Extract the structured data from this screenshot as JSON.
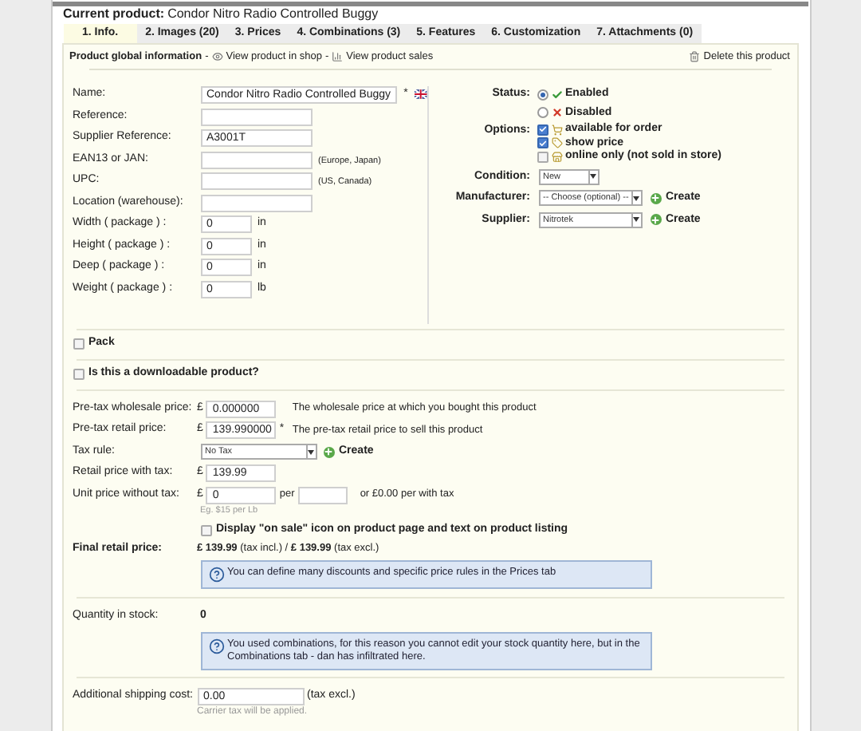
{
  "current_product": {
    "label": "Current product:",
    "name": "Condor Nitro Radio Controlled Buggy"
  },
  "tabs": [
    {
      "label": "1. Info.",
      "selected": true
    },
    {
      "label": "2. Images (20)",
      "selected": false
    },
    {
      "label": "3. Prices",
      "selected": false
    },
    {
      "label": "4. Combinations (3)",
      "selected": false
    },
    {
      "label": "5. Features",
      "selected": false
    },
    {
      "label": "6. Customization",
      "selected": false
    },
    {
      "label": "7. Attachments (0)",
      "selected": false
    }
  ],
  "toolbar": {
    "title": "Product global information",
    "separator_1": "-",
    "view_shop": "View product in shop",
    "separator_2": "-",
    "view_sales": "View product sales",
    "delete": "Delete this product"
  },
  "fields": [
    {
      "label": "Name:",
      "value": "Condor Nitro Radio Controlled Buggy",
      "kind": "long",
      "required": "*",
      "flag": true
    },
    {
      "label": "Reference:",
      "kind": "medium"
    },
    {
      "label": "Supplier Reference:",
      "value": "A3001T",
      "kind": "medium"
    },
    {
      "label": "EAN13 or JAN:",
      "kind": "medium",
      "note": "(Europe, Japan)"
    },
    {
      "label": "UPC:",
      "kind": "medium",
      "note": "(US, Canada)"
    },
    {
      "label": "Location (warehouse):",
      "kind": "medium"
    },
    {
      "label": "Width ( package ) :",
      "value": "0",
      "kind": "short",
      "unit": "in"
    },
    {
      "label": "Height ( package ) :",
      "value": "0",
      "kind": "short",
      "unit": "in"
    },
    {
      "label": "Deep ( package ) :",
      "value": "0",
      "kind": "short",
      "unit": "in"
    },
    {
      "label": "Weight ( package ) :",
      "value": "0",
      "kind": "short",
      "unit": "lb"
    }
  ],
  "status": {
    "label": "Status:",
    "options": [
      {
        "label": "Enabled",
        "kind": "enabled",
        "selected": true
      },
      {
        "label": "Disabled",
        "kind": "disabled",
        "selected": false
      }
    ]
  },
  "options": {
    "label": "Options:",
    "items": [
      {
        "label": "available for order",
        "checked": true
      },
      {
        "label": "show price",
        "checked": true
      },
      {
        "label": "online only (not sold in store)",
        "checked": false
      }
    ]
  },
  "condition": {
    "label": "Condition:",
    "value": "New"
  },
  "manufacturer": {
    "label": "Manufacturer:",
    "value": "-- Choose (optional) --",
    "action": "Create"
  },
  "supplier": {
    "label": "Supplier:",
    "value": "Nitrotek",
    "action": "Create"
  },
  "pack": {
    "label": "Pack",
    "checked": false
  },
  "downloadable": {
    "label": "Is this a downloadable product?",
    "checked": false
  },
  "prices": [
    {
      "label": "Pre-tax wholesale price:",
      "currency": "£",
      "value": "0.000000",
      "note": "The wholesale price at which you bought this product"
    },
    {
      "label": "Pre-tax retail price:",
      "currency": "£",
      "value": "139.990000",
      "required": "*",
      "note": "The pre-tax retail price to sell this product"
    }
  ],
  "tax_rule": {
    "label": "Tax rule:",
    "value": "No Tax",
    "action": "Create"
  },
  "retail_with_tax": {
    "label": "Retail price with tax:",
    "currency": "£",
    "value": "139.99"
  },
  "unit_price": {
    "label": "Unit price without tax:",
    "currency": "£",
    "value": "0",
    "per": "per",
    "note": "or £0.00 per with tax",
    "hint": "Eg. $15 per Lb"
  },
  "on_sale": {
    "label": "Display \"on sale\" icon on product page and text on product listing",
    "checked": false
  },
  "final_price": {
    "label": "Final retail price:",
    "value": "**£ 139.99** (tax incl.) / **£ 139.99** (tax excl.)",
    "info": "You can define many discounts and specific price rules in the Prices tab"
  },
  "quantity": {
    "label": "Quantity in stock:",
    "value": "0",
    "info": "You used combinations, for this reason you cannot edit your stock quantity here, but in the Combinations tab - dan has infiltrated here."
  },
  "shipping": {
    "label": "Additional shipping cost:",
    "value": "0.00",
    "note": "(tax excl.)",
    "hint": "Carrier tax will be applied."
  }
}
